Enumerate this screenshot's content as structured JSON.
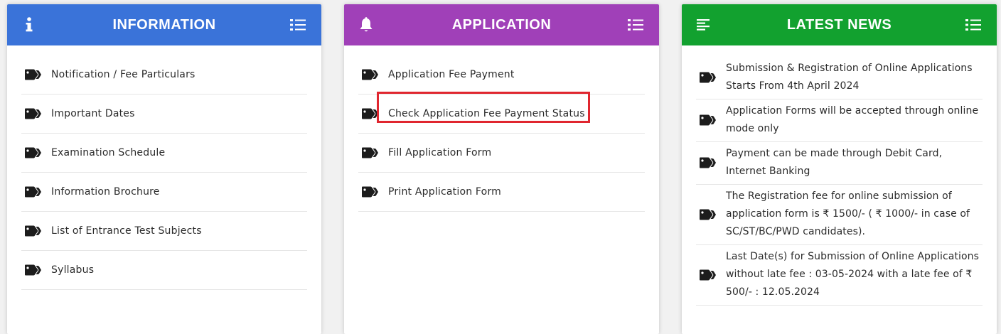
{
  "colors": {
    "information_header": "#3a73d9",
    "application_header": "#a040b8",
    "news_header": "#12a12f",
    "highlight_box": "#e0262f"
  },
  "information": {
    "title": "INFORMATION",
    "header_left_icon": "info-icon",
    "header_right_icon": "list-icon",
    "item_icon": "tags-icon",
    "items": [
      {
        "label": "Notification / Fee Particulars"
      },
      {
        "label": "Important Dates"
      },
      {
        "label": "Examination Schedule"
      },
      {
        "label": "Information Brochure"
      },
      {
        "label": "List of Entrance Test Subjects"
      },
      {
        "label": "Syllabus"
      }
    ]
  },
  "application": {
    "title": "APPLICATION",
    "header_left_icon": "bell-icon",
    "header_right_icon": "list-icon",
    "item_icon": "tags-icon",
    "items": [
      {
        "label": "Application Fee Payment"
      },
      {
        "label": "Check Application Fee Payment Status",
        "highlighted": true
      },
      {
        "label": "Fill Application Form"
      },
      {
        "label": "Print Application Form"
      }
    ]
  },
  "news": {
    "title": "LATEST NEWS",
    "header_left_icon": "align-left-icon",
    "header_right_icon": "list-icon",
    "item_icon": "tags-icon",
    "items": [
      {
        "text": "Submission & Registration of Online Applications Starts From 4th April 2024"
      },
      {
        "text": "Application Forms will be accepted through online mode only"
      },
      {
        "text": "Payment can be made through Debit Card, Internet Banking"
      },
      {
        "text": "The Registration fee for online submission of application form is ₹ 1500/- ( ₹ 1000/- in case of SC/ST/BC/PWD candidates)."
      },
      {
        "text": "Last Date(s) for Submission of Online Applications without late fee : 03-05-2024 with a late fee of ₹ 500/- : 12.05.2024"
      }
    ]
  }
}
